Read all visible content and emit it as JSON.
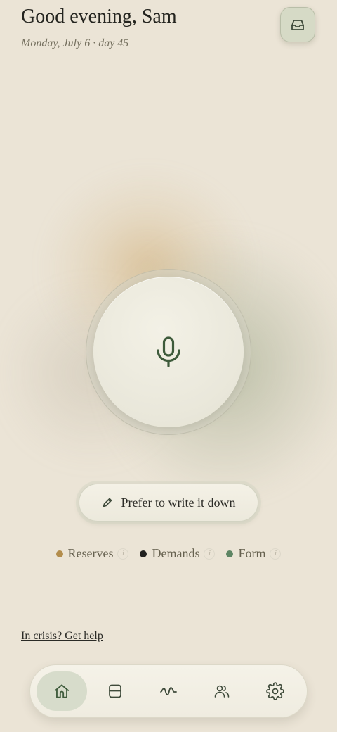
{
  "header": {
    "greeting": "Good evening, Sam",
    "date": "Monday, July 6",
    "separator": "·",
    "day": "day 45",
    "inbox_icon": "inbox-icon"
  },
  "voice": {
    "icon": "microphone-icon",
    "accent_color": "#3e5b3b"
  },
  "write_button": {
    "icon": "pencil-icon",
    "label": "Prefer to write it down"
  },
  "legend": [
    {
      "label": "Reserves",
      "color": "#b38d4c",
      "info_icon": "info-icon"
    },
    {
      "label": "Demands",
      "color": "#222220",
      "info_icon": "info-icon"
    },
    {
      "label": "Form",
      "color": "#5e8564",
      "info_icon": "info-icon"
    }
  ],
  "crisis": {
    "label": "In crisis? Get help"
  },
  "nav": {
    "items": [
      {
        "name": "home",
        "icon": "home-icon",
        "active": true
      },
      {
        "name": "journal",
        "icon": "journal-icon",
        "active": false
      },
      {
        "name": "trends",
        "icon": "wave-icon",
        "active": false
      },
      {
        "name": "people",
        "icon": "people-icon",
        "active": false
      },
      {
        "name": "settings",
        "icon": "gear-icon",
        "active": false
      }
    ]
  },
  "colors": {
    "background": "#ebe4d6",
    "nav_active": "#d7dccb",
    "icon": "#3e5b3b"
  }
}
